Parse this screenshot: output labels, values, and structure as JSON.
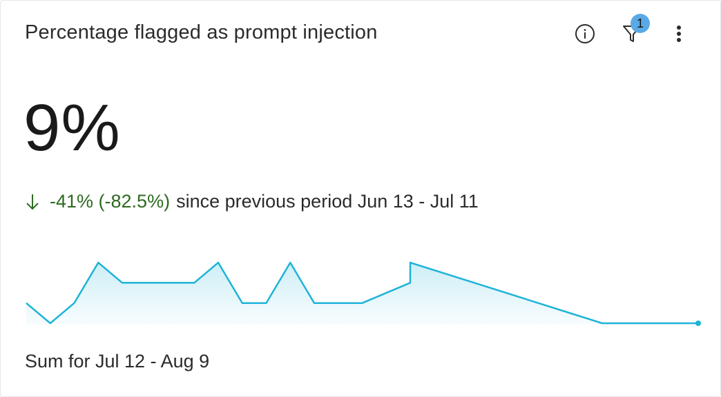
{
  "card": {
    "title": "Percentage flagged as prompt injection",
    "toolbar": {
      "info_icon": "info-icon",
      "filter_icon": "filter-icon",
      "filter_badge": "1",
      "more_icon": "more-vertical-icon"
    },
    "value": "9%",
    "delta": {
      "direction_icon": "arrow-down-icon",
      "change": "-41% (-82.5%)",
      "text": "since previous period Jun 13 - Jul 11"
    },
    "footer": "Sum for Jul 12 - Aug 9"
  },
  "colors": {
    "line": "#1eb3d8",
    "positive_change": "#2e6a1f",
    "badge": "#5aa9e6",
    "text": "#2b2b2b"
  },
  "sparkline": {
    "levels": [
      2,
      1,
      2,
      4,
      3,
      3,
      3,
      3,
      4,
      2,
      2,
      4,
      2,
      2,
      2,
      3,
      4,
      1,
      1,
      1
    ],
    "x_index": [
      0,
      1,
      2,
      3,
      4,
      5,
      6,
      7,
      8,
      9,
      10,
      11,
      12,
      13,
      14,
      16,
      16,
      24,
      26,
      28
    ],
    "note_order": "sequential"
  }
}
